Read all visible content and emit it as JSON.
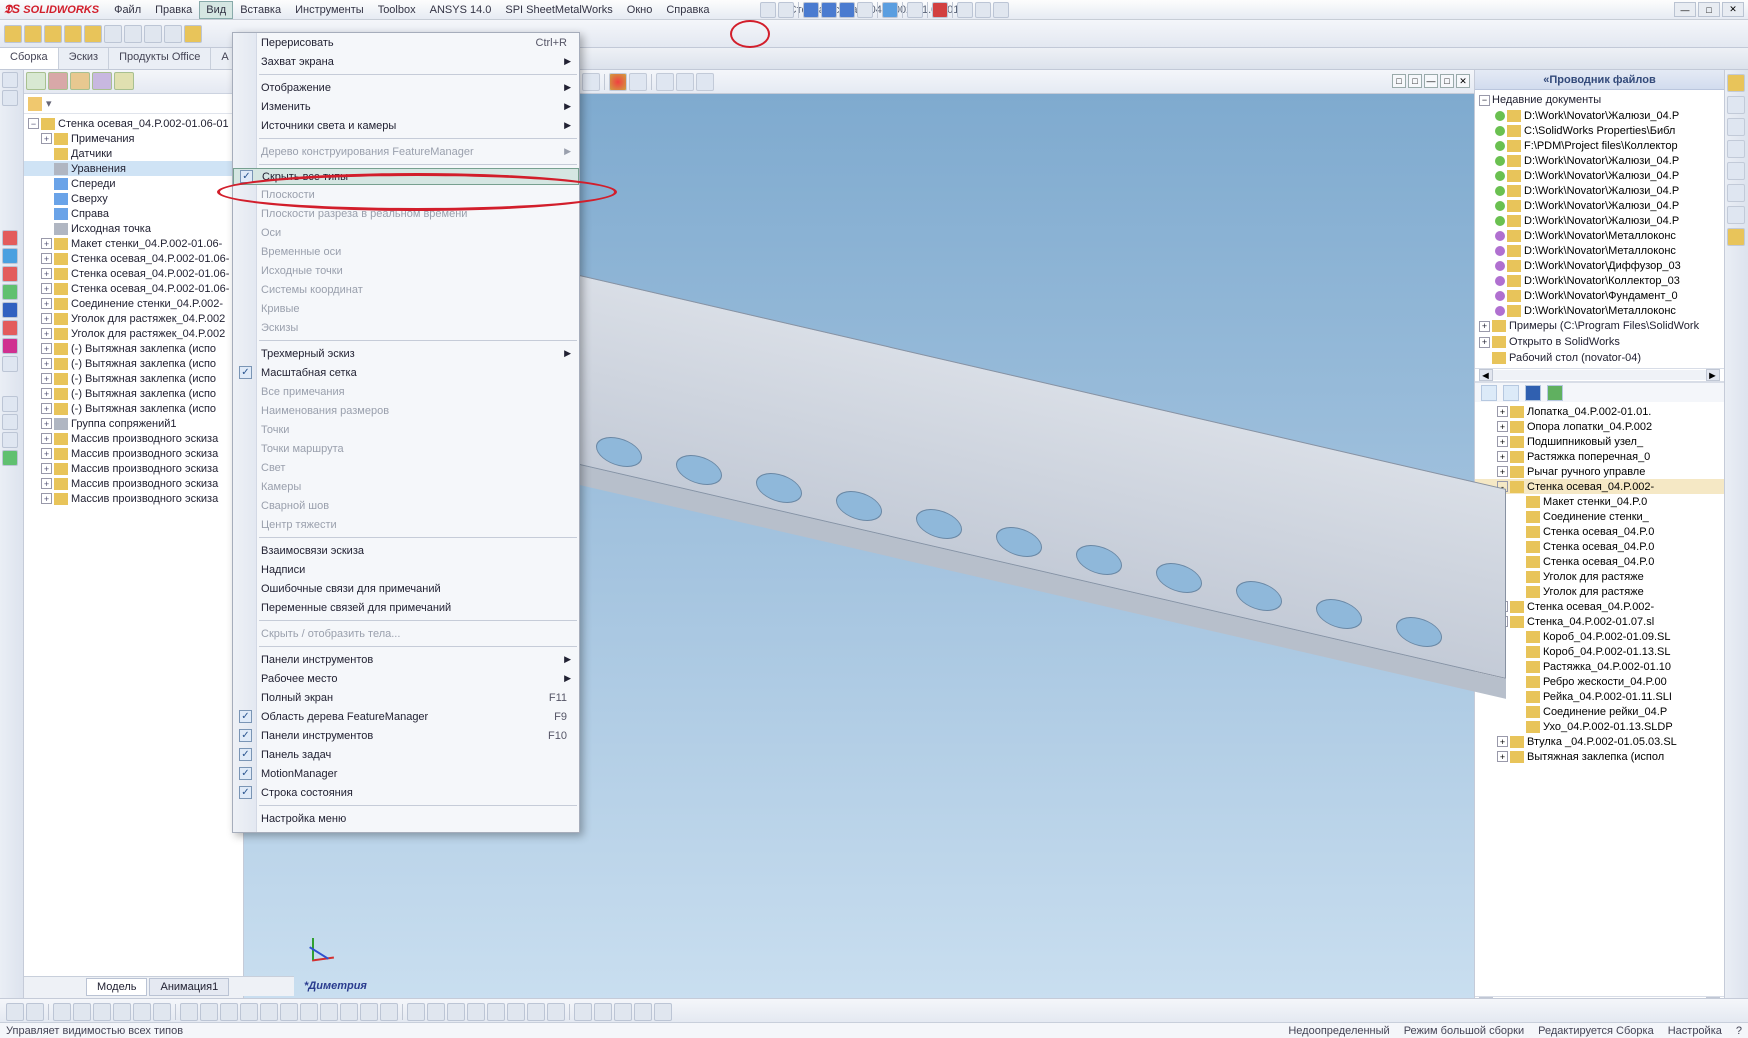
{
  "title": {
    "app": "SOLIDWORKS",
    "doc": "Стенка осевая_04.P.002-01.06-01"
  },
  "menubar": [
    "Файл",
    "Правка",
    "Вид",
    "Вставка",
    "Инструменты",
    "Toolbox",
    "ANSYS 14.0",
    "SPI SheetMetalWorks",
    "Окно",
    "Справка"
  ],
  "tabs": [
    "Сборка",
    "Эскиз",
    "Продукты Office",
    "A"
  ],
  "featuretree": {
    "root": "Стенка осевая_04.P.002-01.06-01",
    "items": [
      {
        "l": "Примечания",
        "d": 1,
        "e": "+"
      },
      {
        "l": "Датчики",
        "d": 1,
        "i": "asm"
      },
      {
        "l": "Уравнения",
        "d": 1,
        "i": "gray",
        "sel": true
      },
      {
        "l": "Спереди",
        "d": 1,
        "i": "blue"
      },
      {
        "l": "Сверху",
        "d": 1,
        "i": "blue"
      },
      {
        "l": "Справа",
        "d": 1,
        "i": "blue"
      },
      {
        "l": "Исходная точка",
        "d": 1,
        "i": "gray"
      },
      {
        "l": "Макет стенки_04.P.002-01.06-",
        "d": 1,
        "e": "+",
        "i": "asm"
      },
      {
        "l": "Стенка осевая_04.P.002-01.06-",
        "d": 1,
        "e": "+",
        "i": "asm"
      },
      {
        "l": "Стенка осевая_04.P.002-01.06-",
        "d": 1,
        "e": "+",
        "i": "asm"
      },
      {
        "l": "Стенка осевая_04.P.002-01.06-",
        "d": 1,
        "e": "+",
        "i": "asm"
      },
      {
        "l": "Соединение стенки_04.P.002-",
        "d": 1,
        "e": "+",
        "i": "asm"
      },
      {
        "l": "Уголок для растяжек_04.P.002",
        "d": 1,
        "e": "+",
        "i": "asm"
      },
      {
        "l": "Уголок для растяжек_04.P.002",
        "d": 1,
        "e": "+",
        "i": "asm"
      },
      {
        "l": "(-) Вытяжная заклепка (испо",
        "d": 1,
        "e": "+",
        "i": "asm"
      },
      {
        "l": "(-) Вытяжная заклепка (испо",
        "d": 1,
        "e": "+",
        "i": "asm"
      },
      {
        "l": "(-) Вытяжная заклепка (испо",
        "d": 1,
        "e": "+",
        "i": "asm"
      },
      {
        "l": "(-) Вытяжная заклепка (испо",
        "d": 1,
        "e": "+",
        "i": "asm"
      },
      {
        "l": "(-) Вытяжная заклепка (испо",
        "d": 1,
        "e": "+",
        "i": "asm"
      },
      {
        "l": "Группа сопряжений1",
        "d": 1,
        "e": "+",
        "i": "gray"
      },
      {
        "l": "Массив производного эскиза",
        "d": 1,
        "e": "+",
        "i": "asm"
      },
      {
        "l": "Массив производного эскиза",
        "d": 1,
        "e": "+",
        "i": "asm"
      },
      {
        "l": "Массив производного эскиза",
        "d": 1,
        "e": "+",
        "i": "asm"
      },
      {
        "l": "Массив производного эскиза",
        "d": 1,
        "e": "+",
        "i": "asm"
      },
      {
        "l": "Массив производного эскиза",
        "d": 1,
        "e": "+",
        "i": "asm"
      }
    ]
  },
  "view_menu": {
    "sections": [
      [
        {
          "l": "Перерисовать",
          "sc": "Ctrl+R"
        },
        {
          "l": "Захват экрана",
          "ar": true
        }
      ],
      [
        {
          "l": "Отображение",
          "ar": true
        },
        {
          "l": "Изменить",
          "ar": true
        },
        {
          "l": "Источники света и камеры",
          "ar": true
        }
      ],
      [
        {
          "l": "Дерево конструирования FeatureManager",
          "ar": true,
          "dis": true
        }
      ],
      [
        {
          "l": "Скрыть все типы",
          "chk": true,
          "hl": true
        },
        {
          "l": "Плоскости",
          "dis": true
        },
        {
          "l": "Плоскости разреза в реальном времени",
          "dis": true
        },
        {
          "l": "Оси",
          "dis": true
        },
        {
          "l": "Временные оси",
          "dis": true
        },
        {
          "l": "Исходные точки",
          "dis": true
        },
        {
          "l": "Системы координат",
          "dis": true
        },
        {
          "l": "Кривые",
          "dis": true
        },
        {
          "l": "Эскизы",
          "dis": true
        }
      ],
      [
        {
          "l": "Трехмерный эскиз",
          "ar": true
        },
        {
          "l": "Масштабная сетка",
          "chk": true
        },
        {
          "l": "Все примечания",
          "dis": true
        },
        {
          "l": "Наименования размеров",
          "dis": true
        },
        {
          "l": "Точки",
          "dis": true
        },
        {
          "l": "Точки маршрута",
          "dis": true
        },
        {
          "l": "Свет",
          "dis": true
        },
        {
          "l": "Камеры",
          "dis": true
        },
        {
          "l": "Сварной шов",
          "dis": true
        },
        {
          "l": "Центр тяжести",
          "dis": true
        }
      ],
      [
        {
          "l": "Взаимосвязи эскиза"
        },
        {
          "l": "Надписи"
        },
        {
          "l": "Ошибочные связи для примечаний"
        },
        {
          "l": "Переменные связей для примечаний"
        }
      ],
      [
        {
          "l": "Скрыть / отобразить тела...",
          "dis": true
        }
      ],
      [
        {
          "l": "Панели инструментов",
          "ar": true
        },
        {
          "l": "Рабочее место",
          "ar": true
        },
        {
          "l": "Полный экран",
          "sc": "F11"
        },
        {
          "l": "Область дерева FeatureManager",
          "chk": true,
          "sc": "F9"
        },
        {
          "l": "Панели инструментов",
          "chk": true,
          "sc": "F10"
        },
        {
          "l": "Панель задач",
          "chk": true
        },
        {
          "l": "MotionManager",
          "chk": true
        },
        {
          "l": "Строка состояния",
          "chk": true
        }
      ],
      [
        {
          "l": "Настройка меню"
        }
      ]
    ]
  },
  "rightpanel": {
    "title": "Проводник файлов",
    "recent_head": "Недавние документы",
    "recent": [
      {
        "d": "g",
        "l": "D:\\Work\\Novator\\Жалюзи_04.P"
      },
      {
        "d": "g",
        "l": "C:\\SolidWorks Properties\\Библ"
      },
      {
        "d": "g",
        "l": "F:\\PDM\\Project files\\Коллектор"
      },
      {
        "d": "g",
        "l": "D:\\Work\\Novator\\Жалюзи_04.P"
      },
      {
        "d": "g",
        "l": "D:\\Work\\Novator\\Жалюзи_04.P"
      },
      {
        "d": "g",
        "l": "D:\\Work\\Novator\\Жалюзи_04.P"
      },
      {
        "d": "g",
        "l": "D:\\Work\\Novator\\Жалюзи_04.P"
      },
      {
        "d": "g",
        "l": "D:\\Work\\Novator\\Жалюзи_04.P"
      },
      {
        "d": "p",
        "l": "D:\\Work\\Novator\\Металлоконс"
      },
      {
        "d": "p",
        "l": "D:\\Work\\Novator\\Металлоконс"
      },
      {
        "d": "p",
        "l": "D:\\Work\\Novator\\Диффузор_03"
      },
      {
        "d": "p",
        "l": "D:\\Work\\Novator\\Коллектор_03"
      },
      {
        "d": "p",
        "l": "D:\\Work\\Novator\\Фундамент_0"
      },
      {
        "d": "p",
        "l": "D:\\Work\\Novator\\Металлоконс"
      }
    ],
    "other": [
      {
        "e": "+",
        "l": "Примеры (C:\\Program Files\\SolidWork"
      },
      {
        "e": "+",
        "l": "Открыто в SolidWorks"
      },
      {
        "e": "",
        "l": "Рабочий стол (novator-04)"
      }
    ],
    "tree2": [
      {
        "d": 1,
        "e": "+",
        "l": "Лопатка_04.P.002-01.01."
      },
      {
        "d": 1,
        "e": "+",
        "l": "Опора лопатки_04.P.002"
      },
      {
        "d": 1,
        "e": "+",
        "l": "Подшипниковый узел_"
      },
      {
        "d": 1,
        "e": "+",
        "l": "Растяжка поперечная_0"
      },
      {
        "d": 1,
        "e": "+",
        "l": "Рычаг ручного управле"
      },
      {
        "d": 1,
        "e": "-",
        "l": "Стенка осевая_04.P.002-",
        "sel": true
      },
      {
        "d": 2,
        "l": "Макет стенки_04.P.0"
      },
      {
        "d": 2,
        "l": "Соединение стенки_"
      },
      {
        "d": 2,
        "l": "Стенка осевая_04.P.0"
      },
      {
        "d": 2,
        "l": "Стенка осевая_04.P.0"
      },
      {
        "d": 2,
        "l": "Стенка осевая_04.P.0"
      },
      {
        "d": 2,
        "l": "Уголок для растяже"
      },
      {
        "d": 2,
        "l": "Уголок для растяже"
      },
      {
        "d": 1,
        "e": "+",
        "l": "Стенка осевая_04.P.002-"
      },
      {
        "d": 1,
        "e": "-",
        "l": "Стенка_04.P.002-01.07.sl"
      },
      {
        "d": 2,
        "l": "Короб_04.P.002-01.09.SL"
      },
      {
        "d": 2,
        "l": "Короб_04.P.002-01.13.SL"
      },
      {
        "d": 2,
        "l": "Растяжка_04.P.002-01.10"
      },
      {
        "d": 2,
        "l": "Ребро жескости_04.P.00"
      },
      {
        "d": 2,
        "l": "Рейка_04.P.002-01.11.SLI"
      },
      {
        "d": 2,
        "l": "Соединение рейки_04.P"
      },
      {
        "d": 2,
        "l": "Ухо_04.P.002-01.13.SLDP"
      },
      {
        "d": 1,
        "e": "+",
        "l": "Втулка _04.P.002-01.05.03.SL"
      },
      {
        "d": 1,
        "e": "+",
        "l": "Вытяжная заклепка (испол"
      }
    ]
  },
  "viewport": {
    "dimetria": "*Диметрия"
  },
  "bottomtabs": [
    "Модель",
    "Анимация1"
  ],
  "status": {
    "left": "Управляет видимостью всех типов",
    "right": [
      "Недоопределенный",
      "Режим большой сборки",
      "Редактируется Сборка",
      "Настройка"
    ]
  }
}
